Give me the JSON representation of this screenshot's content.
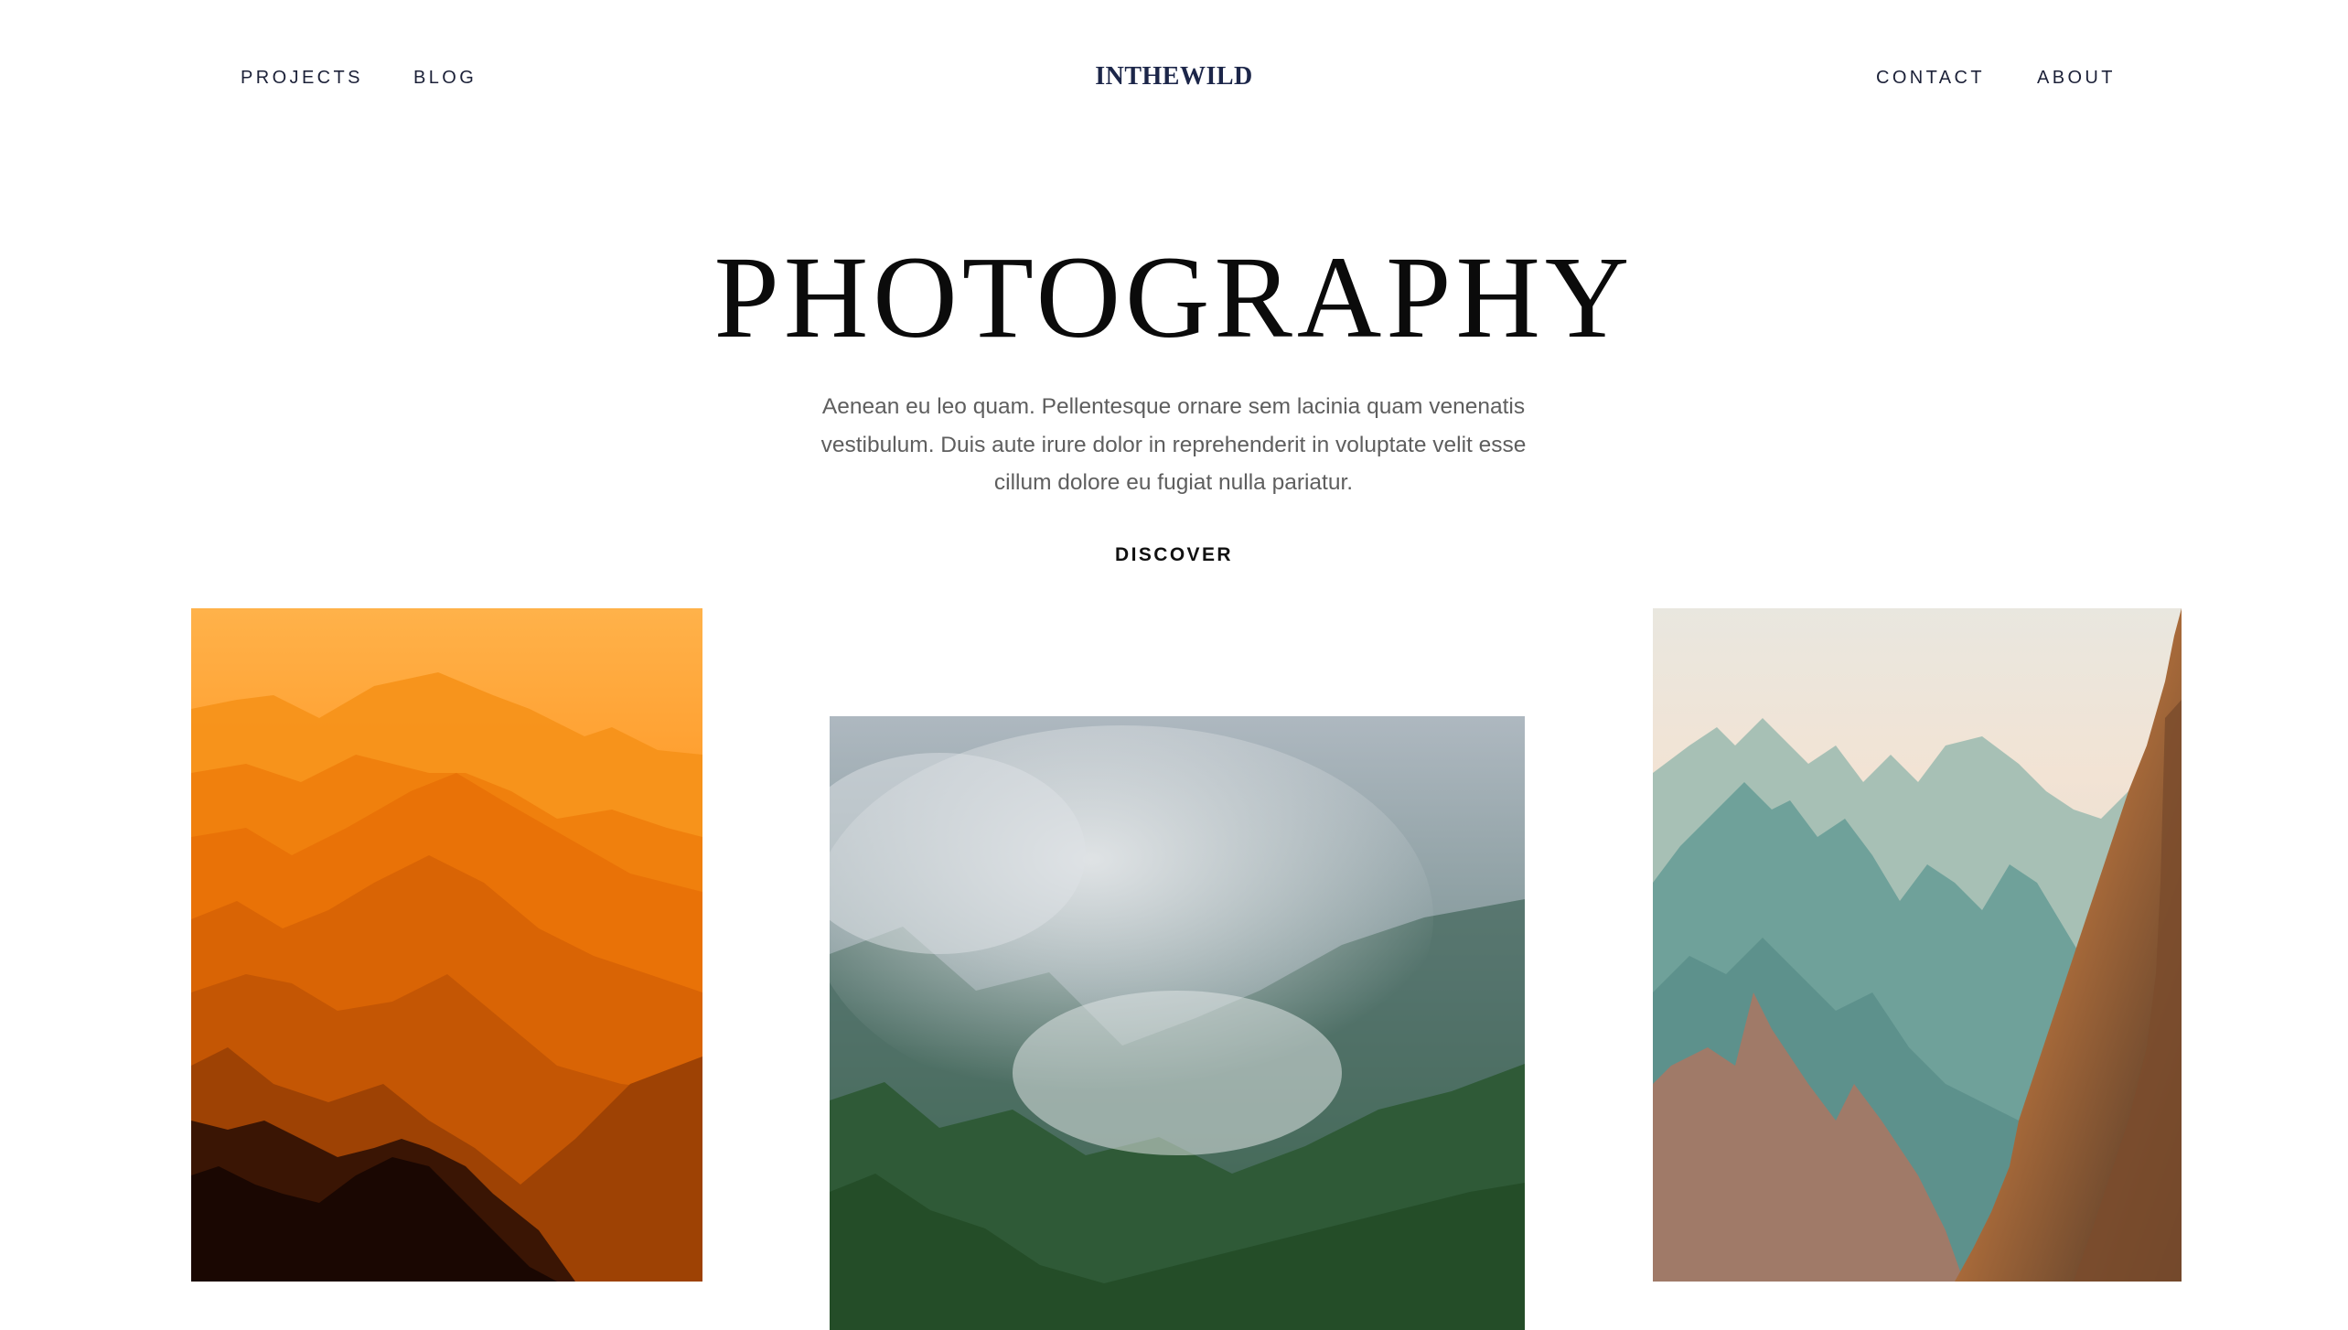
{
  "header": {
    "nav_left": [
      {
        "label": "PROJECTS"
      },
      {
        "label": "BLOG"
      }
    ],
    "logo": "INTHEWILD",
    "nav_right": [
      {
        "label": "CONTACT"
      },
      {
        "label": "ABOUT"
      }
    ]
  },
  "hero": {
    "title": "PHOTOGRAPHY",
    "description": "Aenean eu leo quam. Pellentesque ornare sem lacinia quam venenatis vestibulum. Duis aute irure dolor in reprehenderit in voluptate velit esse cillum dolore eu fugiat nulla pariatur.",
    "cta_label": "DISCOVER"
  },
  "gallery": {
    "photos": [
      {
        "subject": "orange-misty-mountain-ranges"
      },
      {
        "subject": "foggy-green-forest-valley"
      },
      {
        "subject": "teal-mountain-peaks-with-sunlit-cliff"
      }
    ]
  },
  "colors": {
    "background": "#ffffff",
    "nav_text": "#1c2138",
    "logo": "#1c2649",
    "title": "#0b0b0b",
    "body_text": "#5e5e5e"
  }
}
